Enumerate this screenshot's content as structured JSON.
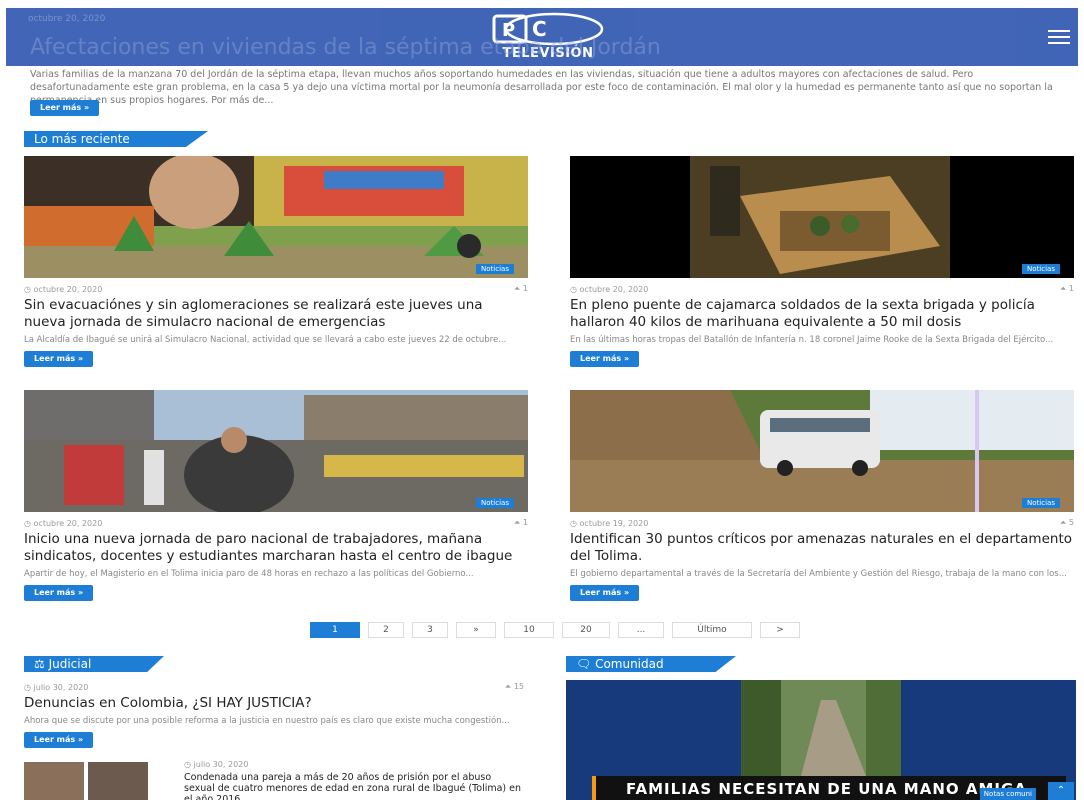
{
  "header": {
    "logo_text": "TELEVISIÓN",
    "logo_mark": "P&C"
  },
  "top_article": {
    "date": "octubre 20, 2020",
    "title": "Afectaciones en viviendas de la séptima etapa del Jordán",
    "excerpt": "Varias familias de la manzana 70 del Jordán de la séptima etapa, llevan muchos años soportando humedades en las viviendas, situación que tiene a adultos mayores con afectaciones de salud. Pero desafortunadamente este gran problema, en la casa 5 ya dejo una víctima mortal por la neumonía desarrollada por este foco de contaminación. El mal olor y la humedad es permanente tanto así que no soportan la permanencia en sus propios hogares. Por más de...",
    "button": "Leer más »"
  },
  "recent": {
    "label": "Lo más reciente",
    "cards": [
      {
        "date": "octubre 20, 2020",
        "likes": "1",
        "badge": "Noticias",
        "title": "Sin evacuaciónes y sin aglomeraciones se realizará este jueves una nueva jornada de simulacro nacional de emergencias",
        "excerpt": "La Alcaldía de Ibagué se unirá al Simulacro Nacional, actividad que se llevará a cabo este jueves 22 de octubre...",
        "button": "Leer más »"
      },
      {
        "date": "octubre 20, 2020",
        "likes": "1",
        "badge": "Noticias",
        "title": "En pleno puente de cajamarca soldados de la sexta brigada y policía hallaron 40 kilos de marihuana equivalente a 50 mil dosis",
        "excerpt": "En las últimas horas tropas del Batallón de Infantería n. 18 coronel Jaime Rooke de la Sexta Brigada del Ejército...",
        "button": "Leer más »"
      },
      {
        "date": "octubre 20, 2020",
        "likes": "1",
        "badge": "Noticias",
        "title": "Inicio una nueva jornada de paro nacional de trabajadores, mañana sindicatos, docentes y estudiantes marcharan hasta el centro de ibague",
        "excerpt": "Apartir de hoy, el Magisterio en el Tolima inicia paro de 48 horas en rechazo a las políticas del Gobierno...",
        "button": "Leer más »"
      },
      {
        "date": "octubre 19, 2020",
        "likes": "5",
        "badge": "Noticias",
        "title": "Identifican 30 puntos críticos por amenazas naturales en el departamento del Tolima.",
        "excerpt": "El gobierno departamental a través de la Secretaría del Ambiente y Gestión del Riesgo, trabaja de la mano con los...",
        "button": "Leer más »"
      }
    ]
  },
  "pagination": [
    "1",
    "2",
    "3",
    "»",
    "10",
    "20",
    "...",
    "Último",
    ">"
  ],
  "judicial": {
    "label": "Judicial",
    "main": {
      "date": "julio 30, 2020",
      "likes": "15",
      "title": "Denuncias en Colombia, ¿SI HAY JUSTICIA?",
      "excerpt": "Ahora que se discute por una posible reforma a la justicia en nuestro país es claro que existe mucha congestión...",
      "button": "Leer más »"
    },
    "secondary": {
      "date": "julio 30, 2020",
      "title": "Condenada una pareja a más de 20 años de prisión por el abuso sexual de cuatro menores de edad en zona rural de Ibagué (Tolima) en el año 2016"
    }
  },
  "comunidad": {
    "label": "Comunidad",
    "caption": "FAMILIAS NECESITAN DE UNA MANO AMIGA",
    "notas": "Notas comuni"
  },
  "colors": {
    "header": "#3a5fb4",
    "accent": "#1e7ed6"
  }
}
